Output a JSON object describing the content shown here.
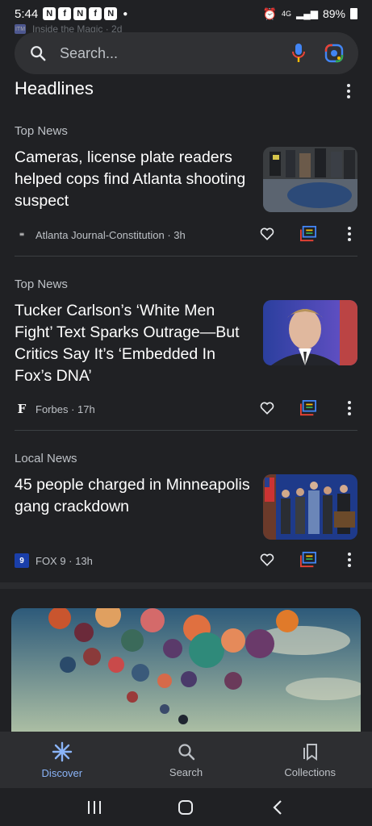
{
  "status_bar": {
    "time": "5:44",
    "network": "4G",
    "battery": "89%"
  },
  "ghost_row": {
    "text": "Inside the Magic · 2d"
  },
  "search": {
    "placeholder": "Search..."
  },
  "section": {
    "title": "Headlines"
  },
  "cards": [
    {
      "category": "Top News",
      "headline": "Cameras, license plate readers helped cops find Atlanta shooting suspect",
      "source": "Atlanta Journal-Constitution · 3h",
      "source_icon": "ajc-logo"
    },
    {
      "category": "Top News",
      "headline": "Tucker Carlson’s ‘White Men Fight’ Text Sparks Outrage—But Critics Say It’s ‘Embedded In Fox’s DNA’",
      "source": "Forbes · 17h",
      "source_icon": "forbes-logo"
    },
    {
      "category": "Local News",
      "headline": "45 people charged in Minneapolis gang crackdown",
      "source": "FOX 9 · 13h",
      "source_icon": "fox9-logo"
    }
  ],
  "bottom_nav": {
    "items": [
      {
        "label": "Discover",
        "icon": "discover-icon",
        "active": true
      },
      {
        "label": "Search",
        "icon": "search-icon",
        "active": false
      },
      {
        "label": "Collections",
        "icon": "collections-icon",
        "active": false
      }
    ]
  },
  "colors": {
    "background": "#202124",
    "accent": "#8ab4f8"
  }
}
